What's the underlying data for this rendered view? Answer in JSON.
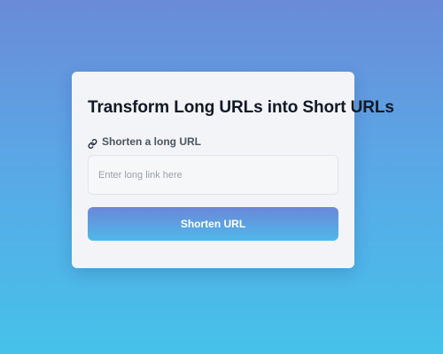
{
  "card": {
    "title": "Transform Long URLs into Short URLs",
    "label": {
      "icon": "link-icon",
      "text": "Shorten a long URL"
    },
    "input": {
      "value": "",
      "placeholder": "Enter long link here"
    },
    "button": {
      "label": "Shorten URL"
    }
  },
  "colors": {
    "background_top": "#6a8bd8",
    "background_bottom": "#45c2ea",
    "card": "#f3f4f7",
    "button_top": "#6b86da",
    "button_bottom": "#4fb9e8"
  }
}
